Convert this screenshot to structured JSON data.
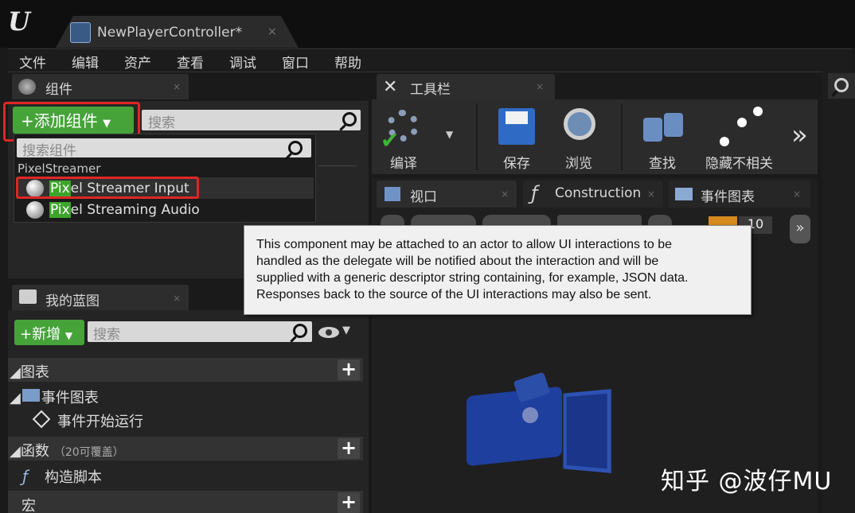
{
  "window": {
    "tab_title": "NewPlayerController*",
    "tab_close": "×",
    "logo": "U"
  },
  "menu": [
    "文件",
    "编辑",
    "资产",
    "查看",
    "调试",
    "窗口",
    "帮助"
  ],
  "components_panel": {
    "tab_label": "组件",
    "add_button": "+添加组件",
    "search_placeholder": "搜索",
    "dropdown": {
      "search_placeholder": "搜索组件",
      "category": "PixelStreamer",
      "items": [
        {
          "highlight": "Pix",
          "rest": "el Streamer Input"
        },
        {
          "highlight": "Pix",
          "rest": "el Streaming Audio"
        }
      ]
    }
  },
  "toolbar": {
    "tab_label": "工具栏",
    "buttons": [
      "编译",
      "保存",
      "浏览",
      "查找",
      "隐藏不相关"
    ],
    "more": "»"
  },
  "viewport_tabs": [
    "视口",
    "Construction",
    "事件图表"
  ],
  "viewport": {
    "speed": "10"
  },
  "tooltip": {
    "lines": [
      "This component may be attached to an actor to allow UI interactions to be",
      "handled as the delegate will be notified about the interaction and will be",
      "supplied with a generic descriptor string containing, for example, JSON data.",
      "Responses back to the source of the UI interactions may also be sent."
    ]
  },
  "my_blueprint": {
    "tab_label": "我的蓝图",
    "new_button": "新增",
    "search_placeholder": "搜索",
    "sections": {
      "graphs": "图表",
      "event_graph": "事件图表",
      "begin_play": "事件开始运行",
      "functions": "函数",
      "functions_hint": "（20可覆盖）",
      "construction_script": "构造脚本",
      "macros": "宏"
    }
  },
  "watermark": "知乎 @波仔MU",
  "colors": {
    "accent_green": "#46a33a",
    "highlight_red": "#e02525",
    "tooltip_bg": "#f0f0f0"
  }
}
